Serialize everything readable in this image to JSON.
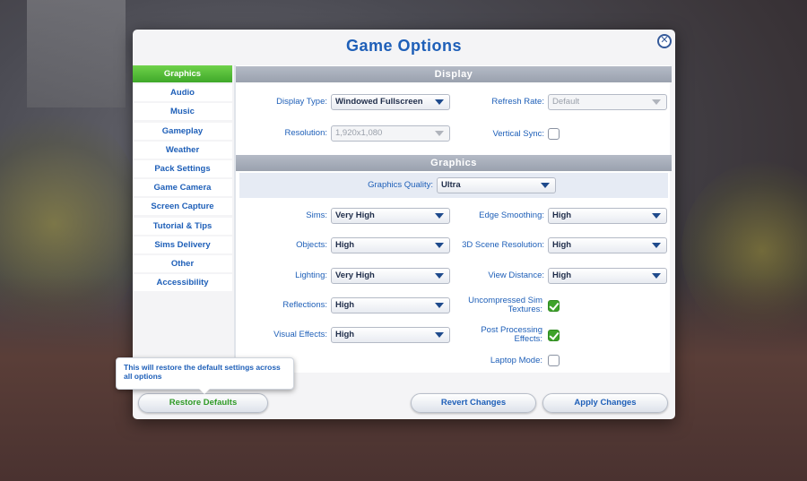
{
  "dialog": {
    "title": "Game Options"
  },
  "sidebar": {
    "items": [
      {
        "label": "Graphics",
        "active": true
      },
      {
        "label": "Audio"
      },
      {
        "label": "Music"
      },
      {
        "label": "Gameplay"
      },
      {
        "label": "Weather"
      },
      {
        "label": "Pack Settings"
      },
      {
        "label": "Game Camera"
      },
      {
        "label": "Screen Capture"
      },
      {
        "label": "Tutorial & Tips"
      },
      {
        "label": "Sims Delivery"
      },
      {
        "label": "Other"
      },
      {
        "label": "Accessibility"
      }
    ]
  },
  "display": {
    "header": "Display",
    "display_type": {
      "label": "Display Type:",
      "value": "Windowed Fullscreen"
    },
    "refresh_rate": {
      "label": "Refresh Rate:",
      "value": "Default"
    },
    "resolution": {
      "label": "Resolution:",
      "value": "1,920x1,080"
    },
    "vertical_sync": {
      "label": "Vertical Sync:",
      "checked": false
    }
  },
  "graphics": {
    "header": "Graphics",
    "quality": {
      "label": "Graphics Quality:",
      "value": "Ultra"
    },
    "sims": {
      "label": "Sims:",
      "value": "Very High"
    },
    "edge_smoothing": {
      "label": "Edge Smoothing:",
      "value": "High"
    },
    "objects": {
      "label": "Objects:",
      "value": "High"
    },
    "scene_resolution": {
      "label": "3D Scene Resolution:",
      "value": "High"
    },
    "lighting": {
      "label": "Lighting:",
      "value": "Very High"
    },
    "view_distance": {
      "label": "View Distance:",
      "value": "High"
    },
    "reflections": {
      "label": "Reflections:",
      "value": "High"
    },
    "uncompressed_textures": {
      "label_line1": "Uncompressed Sim",
      "label_line2": "Textures:",
      "checked": true
    },
    "visual_effects": {
      "label": "Visual Effects:",
      "value": "High"
    },
    "post_processing": {
      "label_line1": "Post Processing",
      "label_line2": "Effects:",
      "checked": true
    },
    "laptop_mode": {
      "label": "Laptop Mode:",
      "checked": false
    }
  },
  "footer": {
    "tooltip": "This will restore the default settings across all options",
    "restore_label": "Restore Defaults",
    "revert_label": "Revert Changes",
    "apply_label": "Apply Changes"
  },
  "colors": {
    "accent": "#1e5fb8",
    "active_tab": "#3fa82a",
    "restore_text": "#2f9a26"
  }
}
